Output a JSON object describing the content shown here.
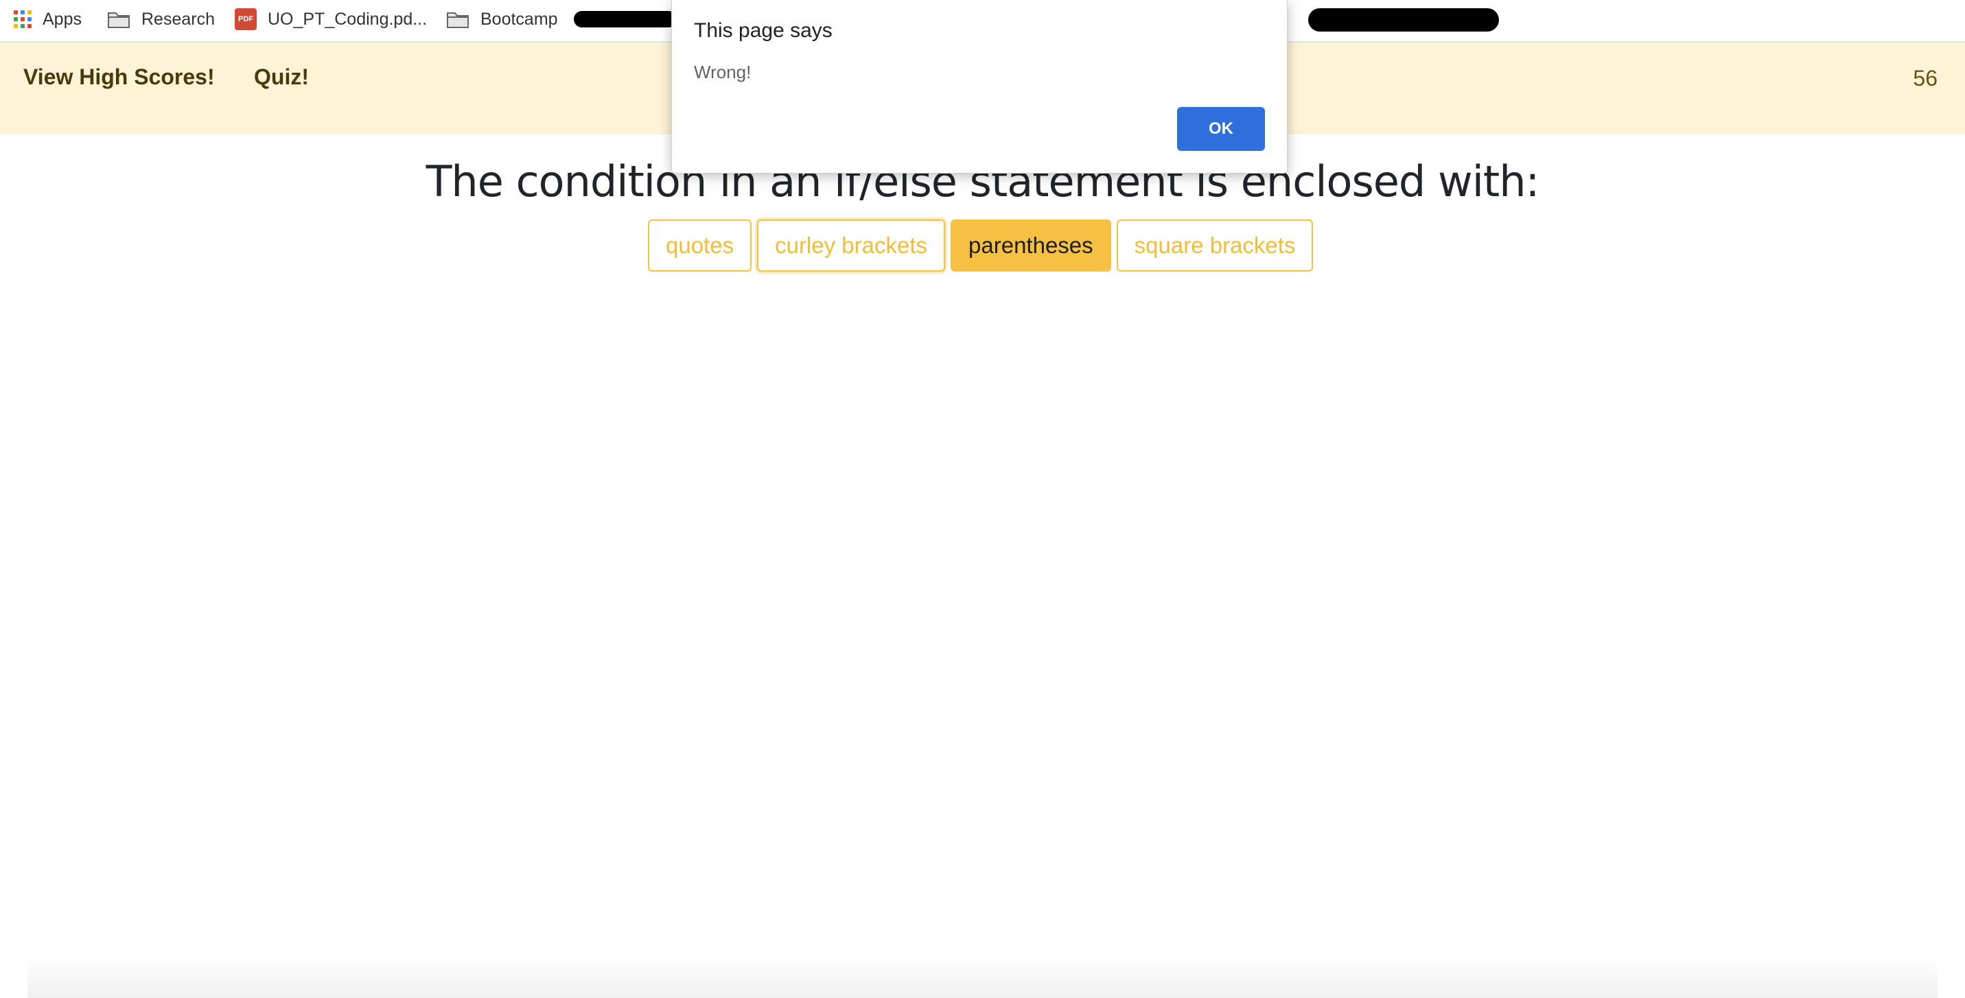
{
  "bookmarks": {
    "items": [
      {
        "label": "Apps",
        "icon": "apps-grid-icon"
      },
      {
        "label": "Research",
        "icon": "folder-icon"
      },
      {
        "label": "UO_PT_Coding.pd...",
        "icon": "pdf-icon"
      },
      {
        "label": "Bootcamp",
        "icon": "folder-icon"
      }
    ],
    "pdf_badge": "PDF"
  },
  "navbar": {
    "high_scores_label": "View High Scores!",
    "quiz_label": "Quiz!",
    "timer_value": "56"
  },
  "quiz": {
    "question": "The condition in an if/else statement is enclosed with:",
    "answers": [
      "quotes",
      "curley brackets",
      "parentheses",
      "square brackets"
    ]
  },
  "dialog": {
    "title": "This page says",
    "message": "Wrong!",
    "ok_label": "OK"
  },
  "colors": {
    "accent": "#f6c142",
    "navbar_bg": "#fdf3d6",
    "ok_button": "#2f6fdc"
  }
}
